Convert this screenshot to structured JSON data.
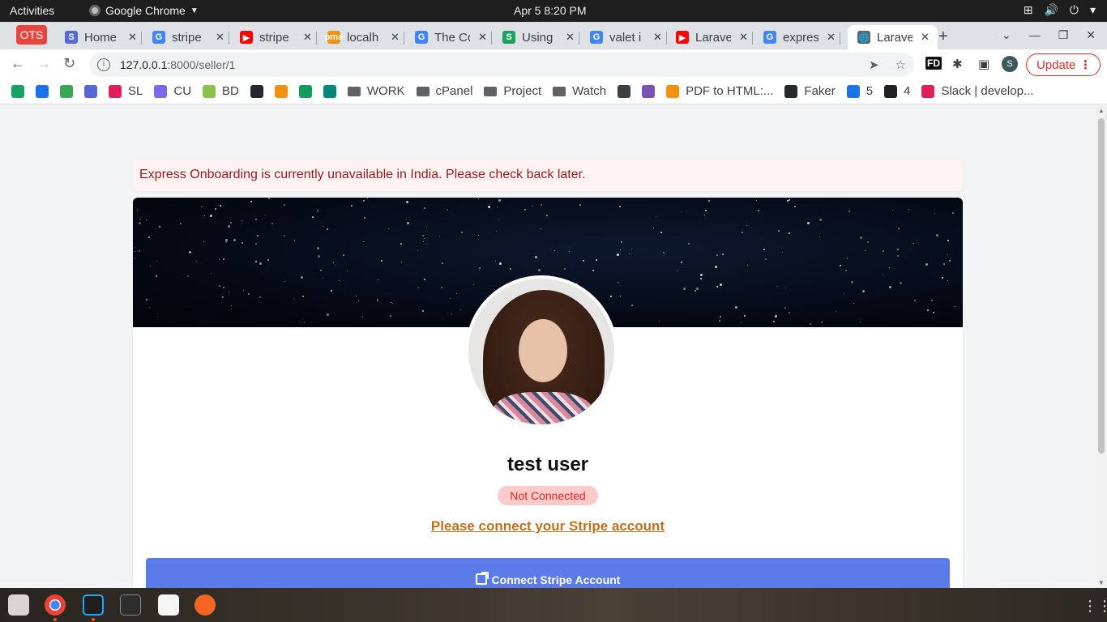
{
  "system": {
    "activities": "Activities",
    "app_name": "Google Chrome",
    "clock": "Apr 5   8:20 PM"
  },
  "browser": {
    "pinned_tab": "OTS",
    "tabs": [
      {
        "title": "Home",
        "favicon": "S",
        "color": "#5469d4"
      },
      {
        "title": "stripe",
        "favicon": "G",
        "color": "#4285f4"
      },
      {
        "title": "stripe",
        "favicon": "▶",
        "color": "#ff0000"
      },
      {
        "title": "localh",
        "favicon": "pma",
        "color": "#f29111"
      },
      {
        "title": "The Co",
        "favicon": "G",
        "color": "#4285f4"
      },
      {
        "title": "Using",
        "favicon": "S",
        "color": "#1aa260"
      },
      {
        "title": "valet i",
        "favicon": "G",
        "color": "#4285f4"
      },
      {
        "title": "Larave",
        "favicon": "▶",
        "color": "#ff0000"
      },
      {
        "title": "expres",
        "favicon": "G",
        "color": "#4285f4"
      },
      {
        "title": "Larave",
        "favicon": "🌐",
        "color": "#5f6368",
        "active": true
      }
    ],
    "url_host": "127.0.0.1",
    "url_path": ":8000/seller/1",
    "update_label": "Update",
    "profile_initial": "S",
    "bookmarks": [
      {
        "label": "",
        "color": "#1aa260"
      },
      {
        "label": "",
        "color": "#1a73e8"
      },
      {
        "label": "",
        "color": "#34a853"
      },
      {
        "label": "",
        "color": "#5469d4"
      },
      {
        "label": "SL",
        "color": "#e01e5a"
      },
      {
        "label": "CU",
        "color": "#7b68ee"
      },
      {
        "label": "BD",
        "color": "#8bc34a"
      },
      {
        "label": "",
        "color": "#24292e"
      },
      {
        "label": "",
        "color": "#f29111"
      },
      {
        "label": "",
        "color": "#0f9d58"
      },
      {
        "label": "",
        "color": "#00897b"
      },
      {
        "label": "WORK",
        "folder": true
      },
      {
        "label": "cPanel",
        "folder": true
      },
      {
        "label": "Project",
        "folder": true
      },
      {
        "label": "Watch",
        "folder": true
      },
      {
        "label": "",
        "color": "#3c4043"
      },
      {
        "label": "",
        "color": "#7952b3"
      },
      {
        "label": "PDF to HTML:...",
        "color": "#f29111"
      },
      {
        "label": "Faker",
        "color": "#24292e"
      },
      {
        "label": "5",
        "color": "#1a73e8"
      },
      {
        "label": "4",
        "color": "#202124"
      },
      {
        "label": "Slack | develop...",
        "color": "#e01e5a"
      }
    ]
  },
  "page": {
    "alert": "Express Onboarding is currently unavailable in India. Please check back later.",
    "user_name": "test user",
    "status": "Not Connected",
    "connect_prompt": "Please connect your Stripe account",
    "connect_button": "Connect Stripe Account"
  },
  "colors": {
    "alert_bg": "#fef2f2",
    "alert_text": "#991b1b",
    "badge_bg": "#fecaca",
    "badge_text": "#dc2626",
    "link": "#c2701b",
    "button": "#5b7ce8"
  }
}
